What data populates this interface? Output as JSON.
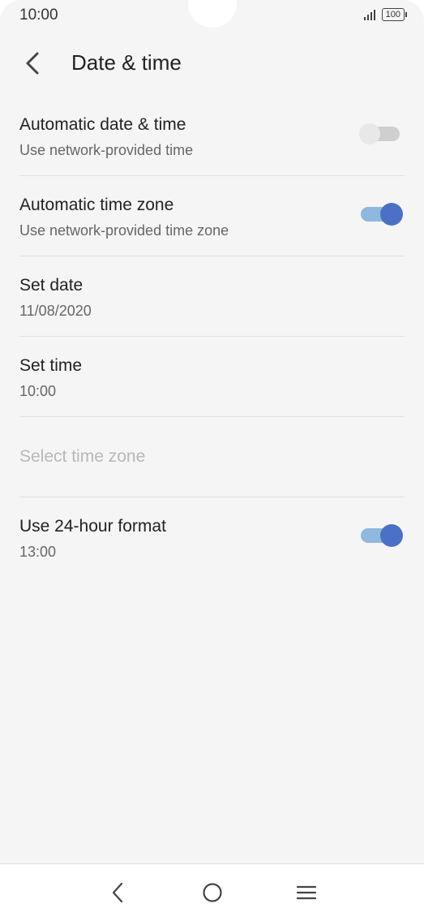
{
  "status_bar": {
    "time": "10:00",
    "battery": "100"
  },
  "header": {
    "title": "Date & time"
  },
  "settings": [
    {
      "title": "Automatic date & time",
      "subtitle": "Use network-provided time",
      "toggle": false
    },
    {
      "title": "Automatic time zone",
      "subtitle": "Use network-provided time zone",
      "toggle": true
    },
    {
      "title": "Set date",
      "subtitle": "11/08/2020"
    },
    {
      "title": "Set time",
      "subtitle": "10:00"
    },
    {
      "title": "Select time zone",
      "subtitle": "",
      "disabled": true
    },
    {
      "title": "Use 24-hour format",
      "subtitle": "13:00",
      "toggle": true
    }
  ],
  "colors": {
    "accent": "#4a70c7",
    "track_on": "#8fb8de",
    "background": "#f5f5f5"
  },
  "icons": {
    "back": "chevron-left-icon",
    "nav_back": "nav-back-icon",
    "nav_home": "nav-home-icon",
    "nav_menu": "nav-menu-icon"
  }
}
